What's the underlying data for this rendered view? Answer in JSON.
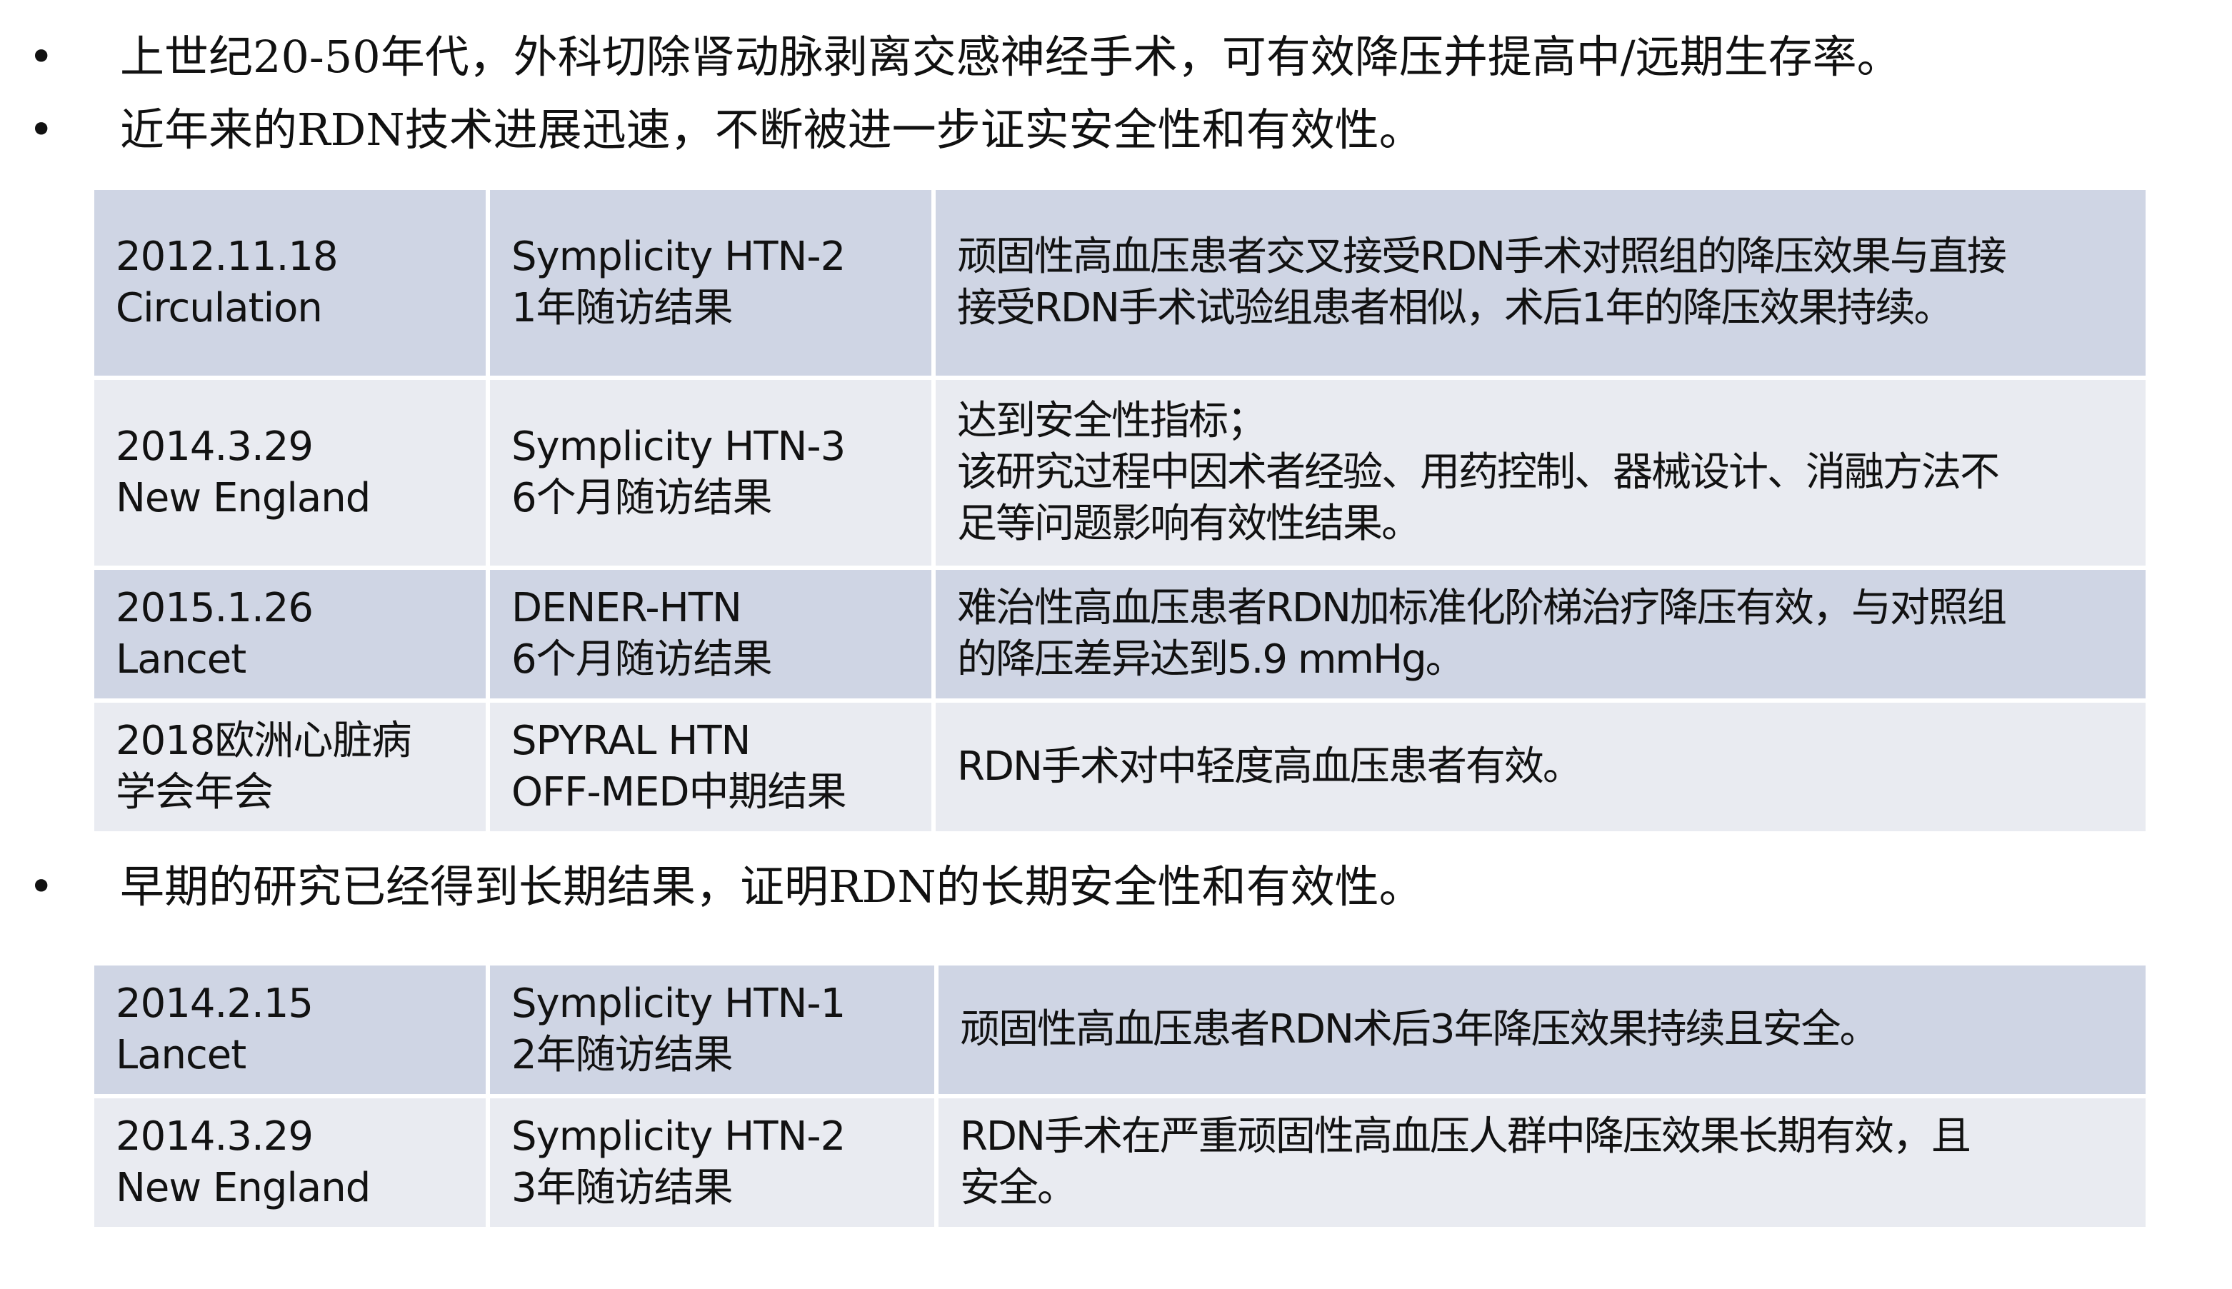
{
  "bullets_top": [
    "上世纪20-50年代，外科切除肾动脉剥离交感神经手术，可有效降压并提高中/远期生存率。",
    "近年来的RDN技术进展迅速，不断被进一步证实安全性和有效性。"
  ],
  "bullet_symbol": "•",
  "table1": {
    "rows": [
      {
        "date": [
          "2012.11.18",
          "Circulation"
        ],
        "study": [
          "Symplicity HTN-2",
          "1年随访结果"
        ],
        "result": [
          "顽固性高血压患者交叉接受RDN手术对照组的降压效果与直接",
          "接受RDN手术试验组患者相似，术后1年的降压效果持续。"
        ]
      },
      {
        "date": [
          "2014.3.29",
          "New England"
        ],
        "study": [
          "Symplicity HTN-3",
          "6个月随访结果"
        ],
        "result": [
          "达到安全性指标；",
          "该研究过程中因术者经验、用药控制、器械设计、消融方法不",
          "足等问题影响有效性结果。"
        ]
      },
      {
        "date": [
          "2015.1.26",
          "Lancet"
        ],
        "study": [
          "DENER-HTN",
          "6个月随访结果"
        ],
        "result": [
          "难治性高血压患者RDN加标准化阶梯治疗降压有效，与对照组",
          "的降压差异达到5.9 mmHg。"
        ]
      },
      {
        "date": [
          "2018欧洲心脏病",
          "学会年会"
        ],
        "study": [
          "SPYRAL HTN",
          "OFF-MED中期结果"
        ],
        "result": [
          "RDN手术对中轻度高血压患者有效。"
        ]
      }
    ]
  },
  "bullet_middle": "早期的研究已经得到长期结果，证明RDN的长期安全性和有效性。",
  "table2": {
    "rows": [
      {
        "date": [
          "2014.2.15",
          "Lancet"
        ],
        "study": [
          "Symplicity HTN-1",
          "2年随访结果"
        ],
        "result": [
          "顽固性高血压患者RDN术后3年降压效果持续且安全。"
        ]
      },
      {
        "date": [
          "2014.3.29",
          "New England"
        ],
        "study": [
          "Symplicity HTN-2",
          "3年随访结果"
        ],
        "result": [
          "RDN手术在严重顽固性高血压人群中降压效果长期有效，且",
          "安全。"
        ]
      }
    ]
  },
  "colors": {
    "row_dark": "#cfd5e4",
    "row_light": "#e9ebf1"
  }
}
